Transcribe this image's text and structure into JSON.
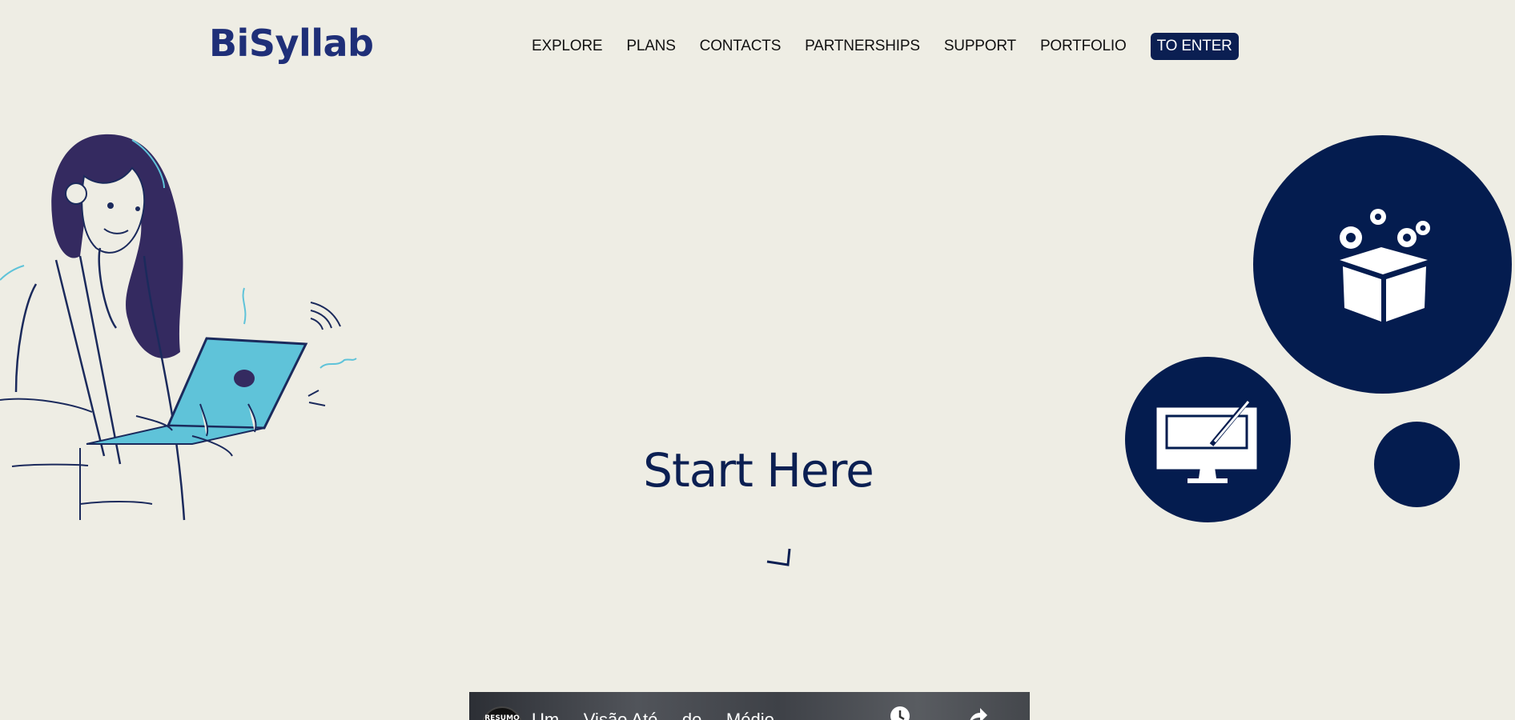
{
  "header": {
    "logo": "BiSyllab",
    "nav": [
      "EXPLORE",
      "PLANS",
      "CONTACTS",
      "PARTNERSHIPS",
      "SUPPORT",
      "PORTFOLIO"
    ],
    "cta": "TO ENTER"
  },
  "hero": {
    "title": "Start Here",
    "illustration_icon": "woman-with-laptop-illustration",
    "circle_icons": [
      "package-gears-icon",
      "monitor-brush-icon",
      "plain-circle"
    ]
  },
  "video": {
    "avatar_text": "RESUMO",
    "title": "Um ... Visão Até ... do ... Médio ...",
    "controls": [
      "watch-later-icon",
      "share-icon"
    ]
  },
  "colors": {
    "background": "#eeede4",
    "navy": "#041c4f",
    "logo": "#1f2f78",
    "laptop": "#5fc3d9"
  }
}
